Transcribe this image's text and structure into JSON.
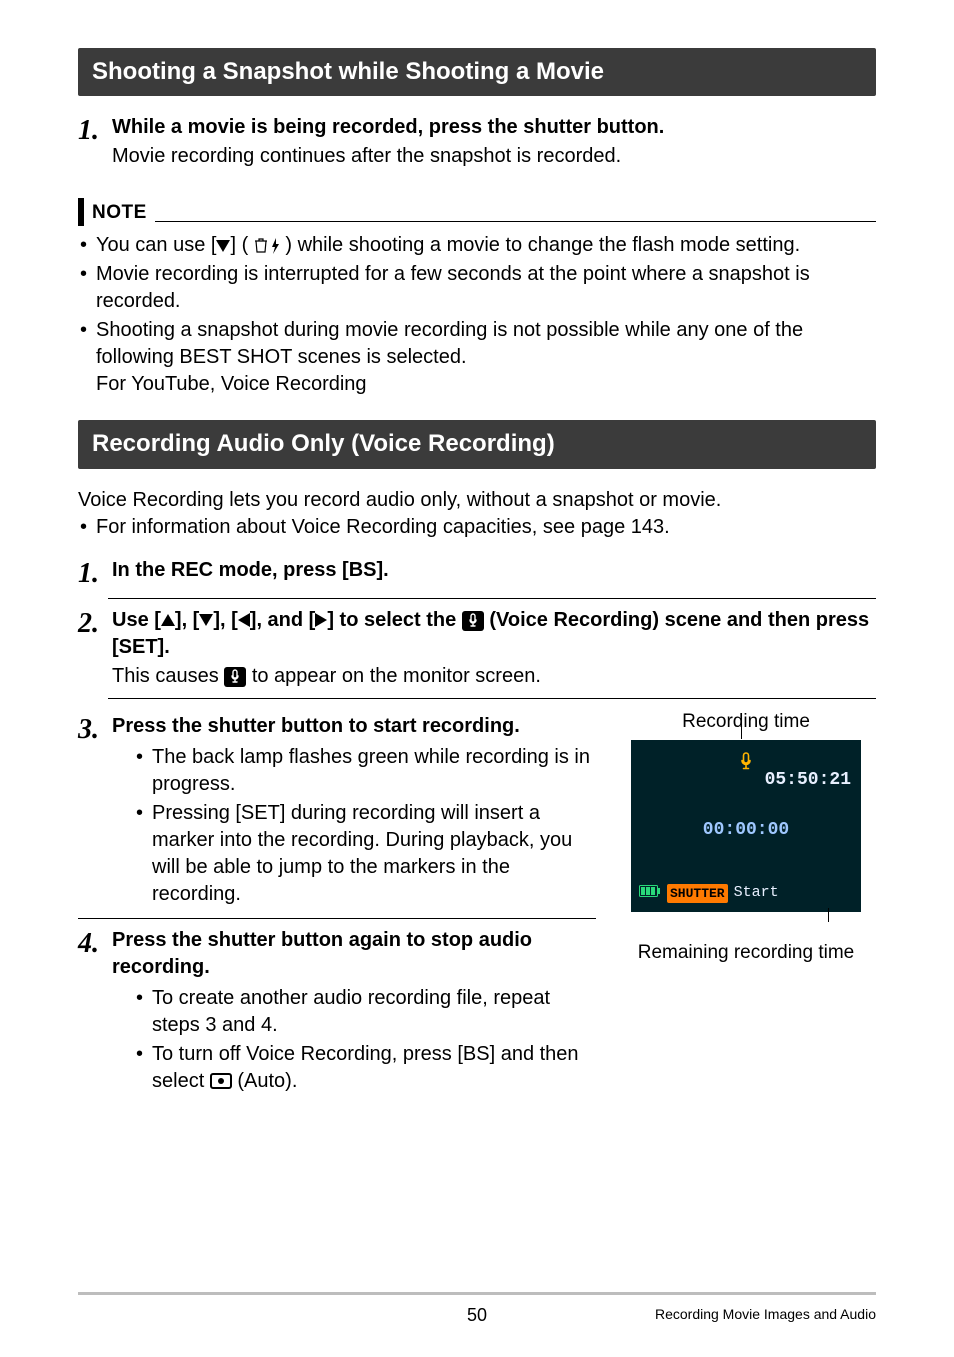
{
  "sections": {
    "snapshot": {
      "header": "Shooting a Snapshot while Shooting a Movie",
      "step1_title": "While a movie is being recorded, press the shutter button.",
      "step1_sub": "Movie recording continues after the snapshot is recorded."
    },
    "note": {
      "label": "NOTE",
      "n1a": "You can use [",
      "n1b": "] (",
      "n1c": ") while shooting a movie to change the flash mode setting.",
      "n2": "Movie recording is interrupted for a few seconds at the point where a snapshot is recorded.",
      "n3": "Shooting a snapshot during movie recording is not possible while any one of the following BEST SHOT scenes is selected.",
      "n3b": "For YouTube, Voice Recording"
    },
    "voice": {
      "header": "Recording Audio Only (Voice Recording)",
      "intro": "Voice Recording lets you record audio only, without a snapshot or movie.",
      "intro_bullet": "For information about Voice Recording capacities, see page 143.",
      "step1": "In the REC mode, press [BS].",
      "step2a": "Use [",
      "step2b": "], [",
      "step2c": "], [",
      "step2d": "], and [",
      "step2e": "] to select the ",
      "step2f": " (Voice Recording) scene and then press [SET].",
      "step2_sub_a": "This causes ",
      "step2_sub_b": " to appear on the monitor screen.",
      "step3_title": "Press the shutter button to start recording.",
      "step3_b1": "The back lamp flashes green while recording is in progress.",
      "step3_b2": "Pressing [SET] during recording will insert a marker into the recording. During playback, you will be able to jump to the markers in the recording.",
      "step4_title": "Press the shutter button again to stop audio recording.",
      "step4_b1": "To create another audio recording file, repeat steps 3 and 4.",
      "step4_b2a": "To turn off Voice Recording, press [BS] and then select ",
      "step4_b2b": " (Auto)."
    },
    "lcd": {
      "caption_top": "Recording time",
      "caption_bottom": "Remaining recording time",
      "remain": "05:50:21",
      "elapsed": "00:00:00",
      "shutter": "SHUTTER",
      "start": "Start"
    }
  },
  "footer": {
    "page": "50",
    "chapter": "Recording Movie Images and Audio"
  }
}
